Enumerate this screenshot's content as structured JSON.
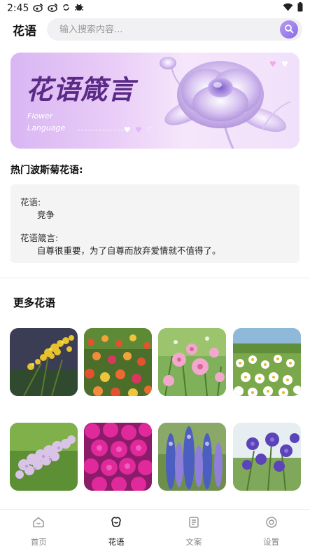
{
  "status": {
    "time": "2:45",
    "left_icons": [
      "weibo-icon",
      "weibo-icon",
      "sync-icon",
      "bug-icon"
    ],
    "right_icons": [
      "wifi-icon",
      "battery-icon"
    ]
  },
  "header": {
    "title": "花语",
    "search_placeholder": "输入搜索内容..."
  },
  "banner": {
    "title": "花语箴言",
    "sub_line1": "Flower",
    "sub_line2": "Language"
  },
  "hot": {
    "title": "热门波斯菊花语:",
    "meaning_label": "花语:",
    "meaning_value": "竞争",
    "quote_label": "花语箴言:",
    "quote_value": "自尊很重要，为了自尊而放弃爱情就不值得了。"
  },
  "more": {
    "title": "更多花语",
    "flowers": [
      {
        "icon": "goldenrod-flower-image"
      },
      {
        "icon": "cosmos-field-image"
      },
      {
        "icon": "pink-cosmos-image"
      },
      {
        "icon": "white-daisy-image"
      },
      {
        "icon": "lilac-flower-image"
      },
      {
        "icon": "magenta-phlox-image"
      },
      {
        "icon": "delphinium-image"
      },
      {
        "icon": "bellflower-image"
      }
    ]
  },
  "tabs": [
    {
      "label": "首页",
      "icon": "home-icon",
      "active": false
    },
    {
      "label": "花语",
      "icon": "flower-icon",
      "active": true
    },
    {
      "label": "文案",
      "icon": "document-icon",
      "active": false
    },
    {
      "label": "设置",
      "icon": "settings-icon",
      "active": false
    }
  ],
  "colors": {
    "accent": "#8a6ae6",
    "banner_title": "#5a2a86",
    "card_bg": "#f4f4f4"
  }
}
